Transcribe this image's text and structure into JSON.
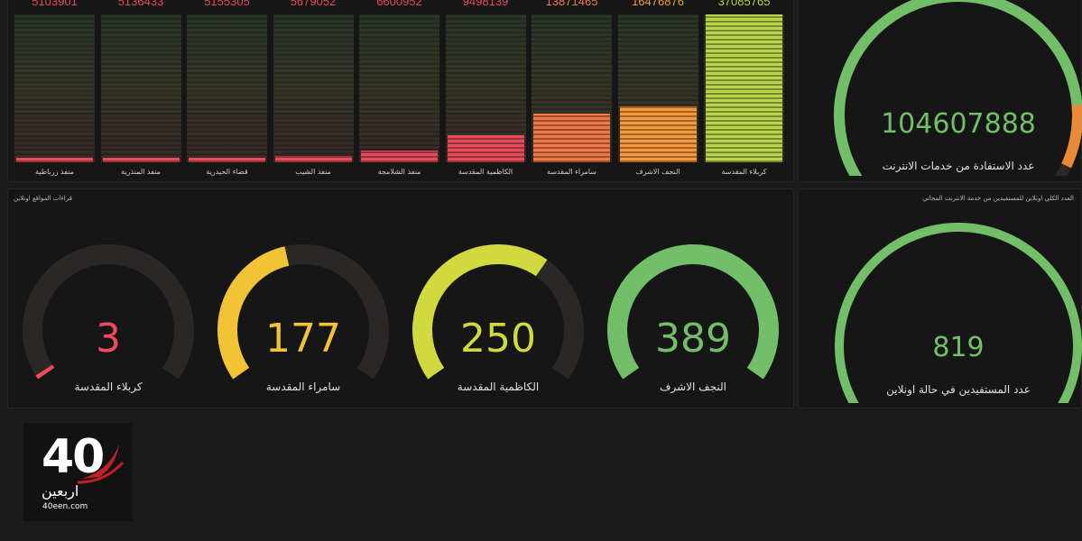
{
  "bar_chart": {
    "bars": [
      {
        "label": "منفذ زرباطية",
        "value": "5103901",
        "color": "#e84c5a",
        "fill": 0.03
      },
      {
        "label": "منفذ المنذرية",
        "value": "5136433",
        "color": "#e84c5a",
        "fill": 0.03
      },
      {
        "label": "قضاء الحيدرية",
        "value": "5155305",
        "color": "#e84c5a",
        "fill": 0.03
      },
      {
        "label": "منفذ الشيب",
        "value": "5679052",
        "color": "#e84c5a",
        "fill": 0.04
      },
      {
        "label": "منفذ الشلامجة",
        "value": "6600952",
        "color": "#e84c5a",
        "fill": 0.08
      },
      {
        "label": "الكاظمية المقدسة",
        "value": "9498139",
        "color": "#e84c5a",
        "fill": 0.18
      },
      {
        "label": "سامراء المقدسة",
        "value": "13871465",
        "color": "#f07a4a",
        "fill": 0.33
      },
      {
        "label": "النجف الاشرف",
        "value": "16476876",
        "color": "#f59a3c",
        "fill": 0.38
      },
      {
        "label": "كربلاء المقدسة",
        "value": "37085765",
        "color": "#b9d34a",
        "fill": 1.0
      }
    ]
  },
  "total_panel": {
    "value": "104607888",
    "label": "عدد الاستفادة من خدمات الانترنت",
    "fraction": 0.92,
    "color": "#73bf69"
  },
  "online_panel": {
    "title": "قراءات المواقع اونلاين",
    "gauges": [
      {
        "value": "3",
        "label": "كربلاء المقدسة",
        "fraction": 0.01,
        "color": "#f2495c"
      },
      {
        "value": "177",
        "label": "سامراء المقدسة",
        "fraction": 0.45,
        "color": "#f2c335"
      },
      {
        "value": "250",
        "label": "الكاظمية المقدسة",
        "fraction": 0.64,
        "color": "#d0d93e"
      },
      {
        "value": "389",
        "label": "النجف الاشرف",
        "fraction": 1.0,
        "color": "#73bf69"
      }
    ]
  },
  "online_total_panel": {
    "title": "العدد الكلي اونلاين للمستفيدين من خدمة الانترنت المجاني",
    "value": "819",
    "label": "عدد المستفيدين في حالة اونلاين",
    "fraction": 1.0,
    "color": "#73bf69"
  },
  "logo": {
    "number": "40",
    "arabic": "اربعين",
    "site": "40een.com"
  }
}
